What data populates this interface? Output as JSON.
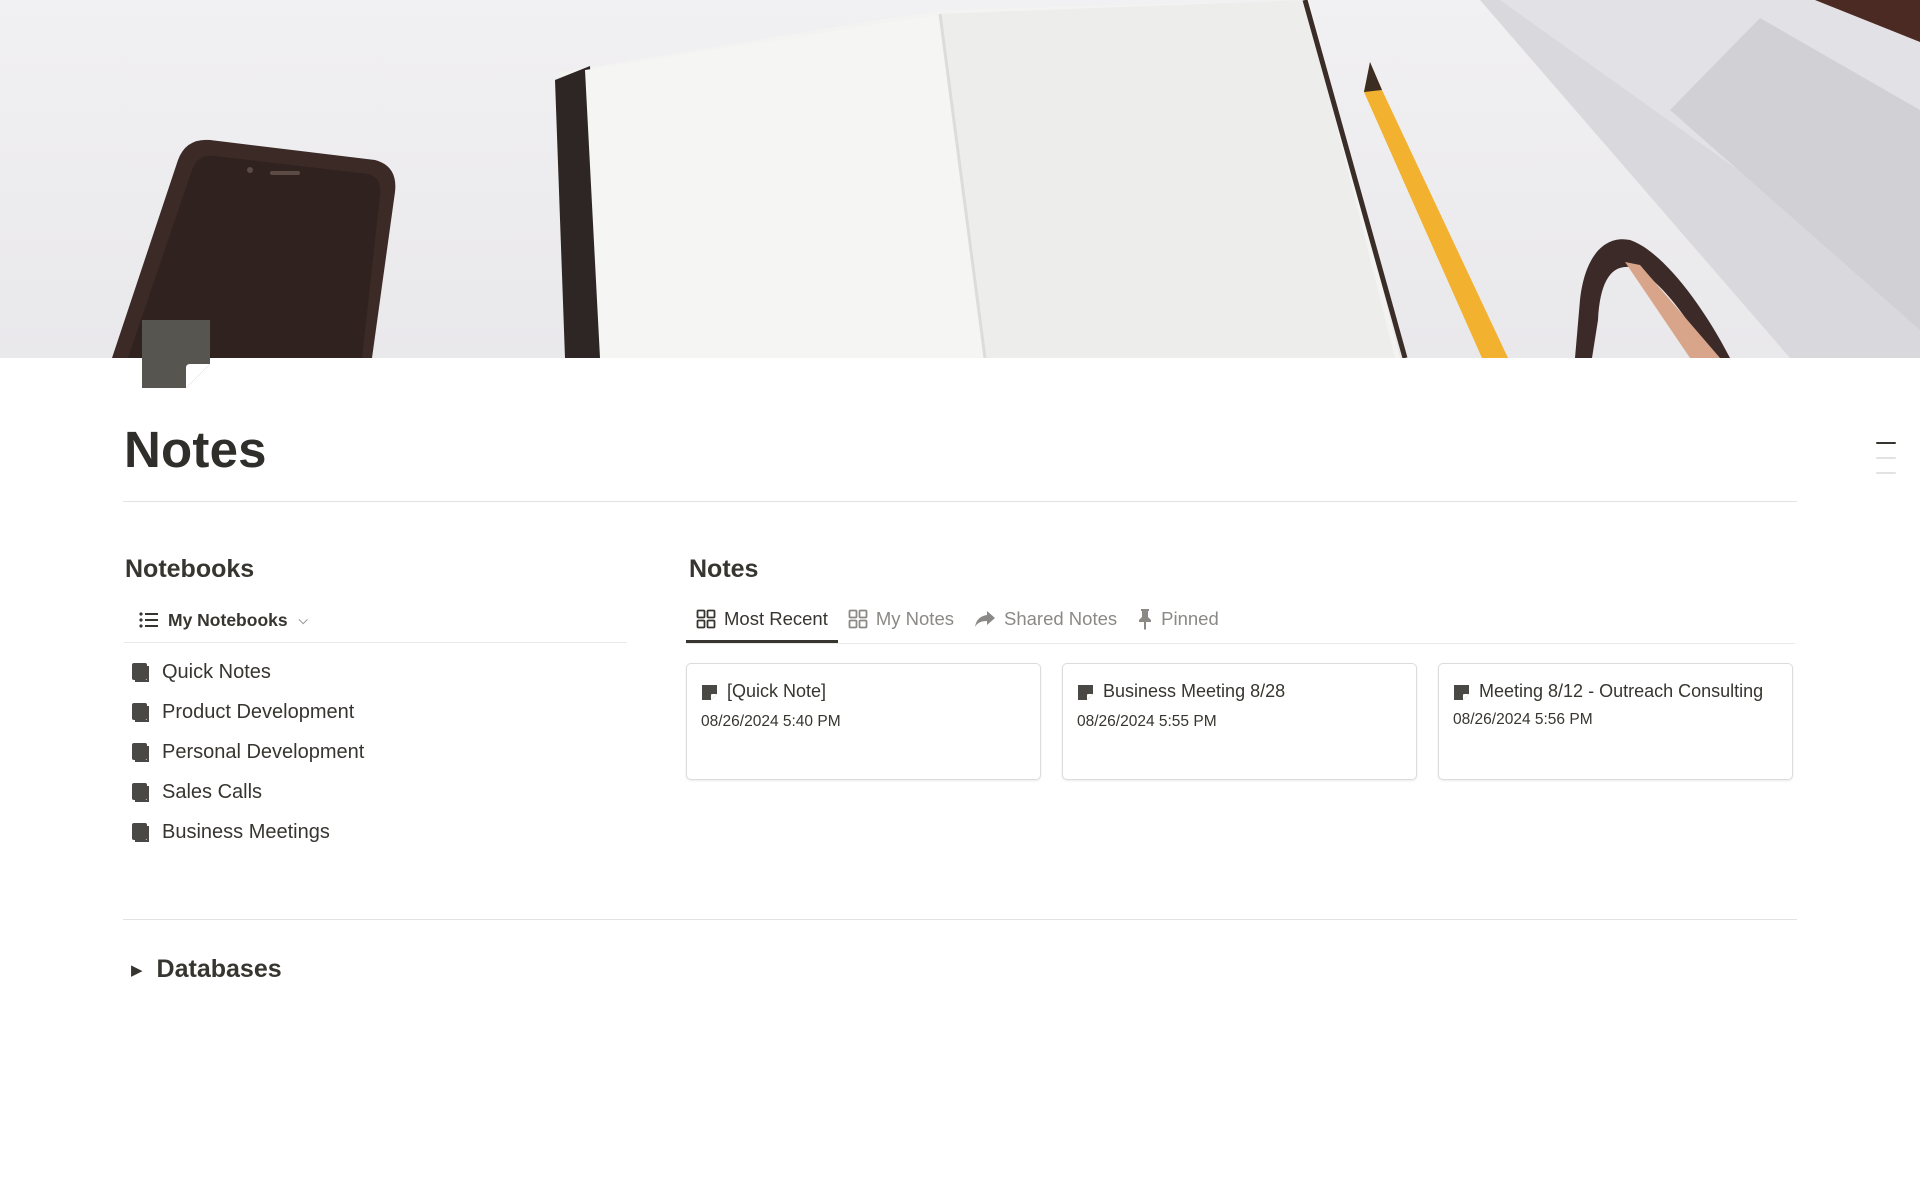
{
  "page": {
    "title": "Notes",
    "icon": "sticky-note-icon"
  },
  "cover": {
    "image": "desk-with-open-notebook-phone-pencil-glasses-laptop"
  },
  "notebooks": {
    "heading": "Notebooks",
    "view_label": "My Notebooks",
    "view_icon": "list-icon",
    "items": [
      {
        "label": "Quick Notes",
        "icon": "notebook-icon"
      },
      {
        "label": "Product Development",
        "icon": "notebook-icon"
      },
      {
        "label": "Personal Development",
        "icon": "notebook-icon"
      },
      {
        "label": "Sales Calls",
        "icon": "notebook-icon"
      },
      {
        "label": "Business Meetings",
        "icon": "notebook-icon"
      }
    ]
  },
  "notes": {
    "heading": "Notes",
    "tabs": [
      {
        "label": "Most Recent",
        "icon": "gallery-icon",
        "active": true
      },
      {
        "label": "My Notes",
        "icon": "gallery-icon",
        "active": false
      },
      {
        "label": "Shared Notes",
        "icon": "share-arrow-icon",
        "active": false
      },
      {
        "label": "Pinned",
        "icon": "pin-icon",
        "active": false
      }
    ],
    "cards": [
      {
        "title": "[Quick Note]",
        "date": "08/26/2024 5:40 PM"
      },
      {
        "title": "Business Meeting 8/28",
        "date": "08/26/2024 5:55 PM"
      },
      {
        "title": "Meeting 8/12 - Outreach Consulting",
        "date": "08/26/2024 5:56 PM"
      }
    ]
  },
  "databases": {
    "label": "Databases",
    "expanded": false
  },
  "colors": {
    "text": "#37352f",
    "muted": "#8a8985",
    "border": "#e3e2e0",
    "icon": "#4a4845"
  }
}
